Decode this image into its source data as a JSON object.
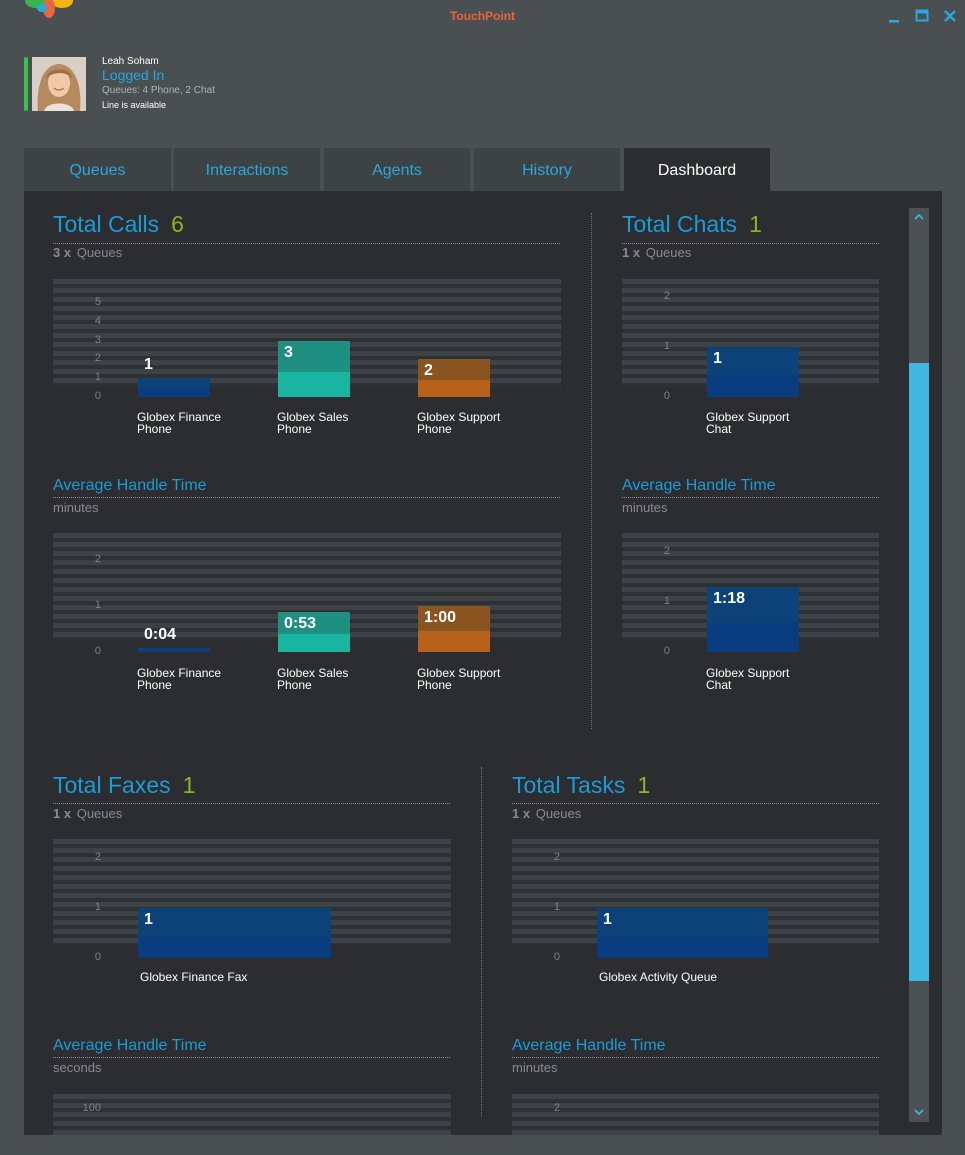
{
  "window": {
    "title": "TouchPoint"
  },
  "user": {
    "name": "Leah Soham",
    "status": "Logged In",
    "queues": "Queues: 4 Phone, 2 Chat",
    "line": "Line is available"
  },
  "tabs": [
    {
      "label": "Queues"
    },
    {
      "label": "Interactions"
    },
    {
      "label": "Agents"
    },
    {
      "label": "History"
    },
    {
      "label": "Dashboard",
      "active": true
    }
  ],
  "colors": {
    "accent": "#1c9bd6",
    "count": "#8bb422",
    "finance": "#0a3c80",
    "sales": "#1ab5a0",
    "support": "#b8611a",
    "scroll": "#3fb7e0"
  },
  "sections": {
    "calls": {
      "title": "Total Calls",
      "count": "6",
      "sub_count": "3 x",
      "sub_label": "Queues",
      "aht_title": "Average Handle Time",
      "aht_unit": "minutes"
    },
    "chats": {
      "title": "Total Chats",
      "count": "1",
      "sub_count": "1 x",
      "sub_label": "Queues",
      "aht_title": "Average Handle Time",
      "aht_unit": "minutes"
    },
    "faxes": {
      "title": "Total Faxes",
      "count": "1",
      "sub_count": "1 x",
      "sub_label": "Queues",
      "aht_title": "Average Handle Time",
      "aht_unit": "seconds"
    },
    "tasks": {
      "title": "Total Tasks",
      "count": "1",
      "sub_count": "1 x",
      "sub_label": "Queues",
      "aht_title": "Average Handle Time",
      "aht_unit": "minutes"
    }
  },
  "chart_data": [
    {
      "type": "bar",
      "id": "calls_total",
      "ylim": [
        0,
        5
      ],
      "yticks": [
        "0",
        "1",
        "2",
        "3",
        "4",
        "5"
      ],
      "categories": [
        "Globex Finance Phone",
        "Globex Sales Phone",
        "Globex Support Phone"
      ],
      "values": [
        1,
        3,
        2
      ],
      "value_labels": [
        "1",
        "3",
        "2"
      ]
    },
    {
      "type": "bar",
      "id": "calls_aht",
      "ylim": [
        0,
        2
      ],
      "yticks": [
        "0",
        "1",
        "2"
      ],
      "categories": [
        "Globex Finance Phone",
        "Globex Sales Phone",
        "Globex Support Phone"
      ],
      "values": [
        0.07,
        0.88,
        1.0
      ],
      "value_labels": [
        "0:04",
        "0:53",
        "1:00"
      ]
    },
    {
      "type": "bar",
      "id": "chats_total",
      "ylim": [
        0,
        2
      ],
      "yticks": [
        "0",
        "1",
        "2"
      ],
      "categories": [
        "Globex Support Chat"
      ],
      "values": [
        1
      ],
      "value_labels": [
        "1"
      ]
    },
    {
      "type": "bar",
      "id": "chats_aht",
      "ylim": [
        0,
        2
      ],
      "yticks": [
        "0",
        "1",
        "2"
      ],
      "categories": [
        "Globex Support Chat"
      ],
      "values": [
        1.3
      ],
      "value_labels": [
        "1:18"
      ]
    },
    {
      "type": "bar",
      "id": "faxes_total",
      "ylim": [
        0,
        2
      ],
      "yticks": [
        "0",
        "1",
        "2"
      ],
      "categories": [
        "Globex Finance Fax"
      ],
      "values": [
        1
      ],
      "value_labels": [
        "1"
      ]
    },
    {
      "type": "bar",
      "id": "tasks_total",
      "ylim": [
        0,
        2
      ],
      "yticks": [
        "0",
        "1",
        "2"
      ],
      "categories": [
        "Globex Activity Queue"
      ],
      "values": [
        1
      ],
      "value_labels": [
        "1"
      ]
    },
    {
      "type": "bar",
      "id": "faxes_aht",
      "yticks": [
        "100"
      ],
      "categories": [],
      "values": []
    },
    {
      "type": "bar",
      "id": "tasks_aht",
      "yticks": [
        "2"
      ],
      "categories": [],
      "values": []
    }
  ]
}
